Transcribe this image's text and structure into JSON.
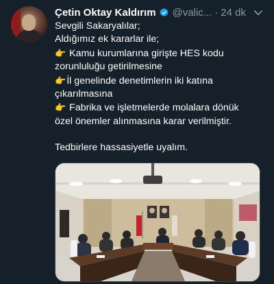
{
  "tweet": {
    "author_name": "Çetin Oktay Kaldırım",
    "handle": "@valic...",
    "separator": "·",
    "time": "24 dk",
    "lines": {
      "l1": "Sevgili Sakaryalılar;",
      "l2": "Aldığımız ek kararlar ile;",
      "l3": "Kamu kurumlarına girişte HES kodu",
      "l4": "zorunluluğu getirilmesine",
      "l5": "İl genelinde denetimlerin iki katına",
      "l6": "çıkarılmasına",
      "l7": "Fabrika ve işletmelerde molalara dönük",
      "l8": "özel önemler alınmasına karar verilmiştir.",
      "l9": "Tedbirlere hassasiyetle uyalım."
    },
    "bullet_icon": "pointing-hand-emoji",
    "colors": {
      "background": "#15202b",
      "text": "#ffffff",
      "muted": "#8899a6",
      "verified": "#1da1f2"
    }
  }
}
